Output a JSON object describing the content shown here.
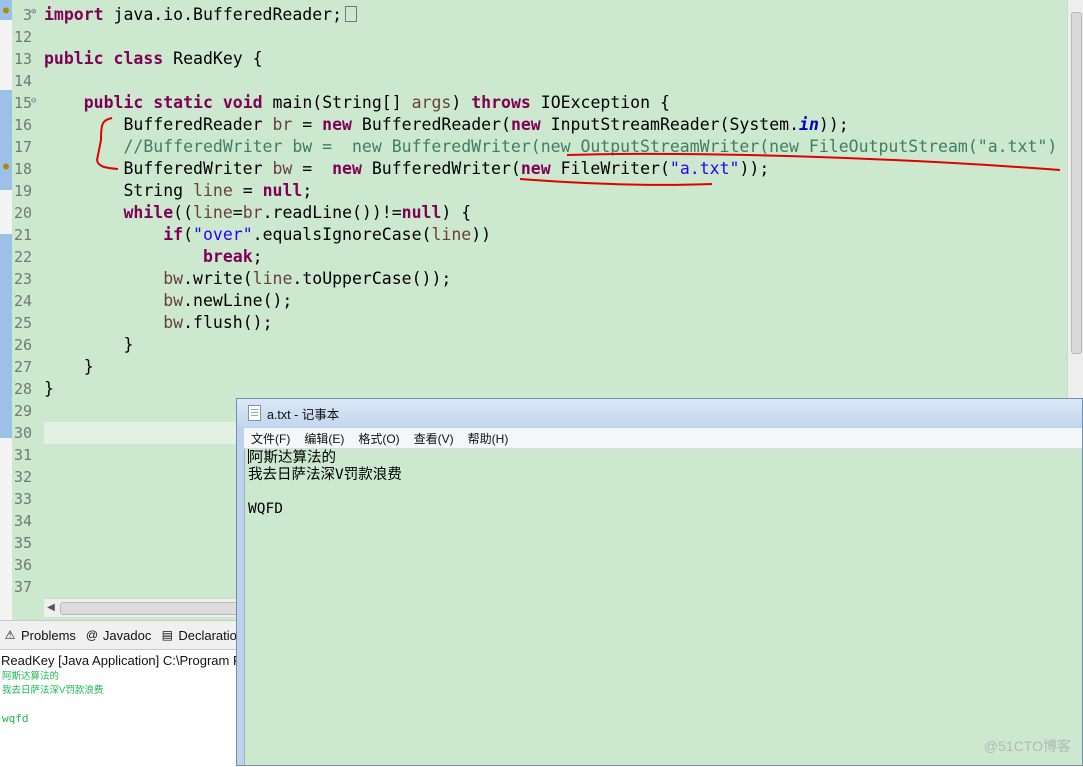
{
  "editor": {
    "lines": [
      {
        "num": "3",
        "segments": [
          {
            "t": "import",
            "c": "kw"
          },
          {
            "t": " java.io.BufferedReader;",
            "c": ""
          }
        ],
        "collapsed": true
      },
      {
        "num": "12",
        "segments": []
      },
      {
        "num": "13",
        "segments": [
          {
            "t": "public",
            "c": "kw"
          },
          {
            "t": " ",
            "c": ""
          },
          {
            "t": "class",
            "c": "kw"
          },
          {
            "t": " ReadKey {",
            "c": ""
          }
        ]
      },
      {
        "num": "14",
        "segments": []
      },
      {
        "num": "15",
        "segments": [
          {
            "t": "    ",
            "c": ""
          },
          {
            "t": "public",
            "c": "kw"
          },
          {
            "t": " ",
            "c": ""
          },
          {
            "t": "static",
            "c": "kw"
          },
          {
            "t": " ",
            "c": ""
          },
          {
            "t": "void",
            "c": "kw"
          },
          {
            "t": " main(String[] ",
            "c": ""
          },
          {
            "t": "args",
            "c": "var"
          },
          {
            "t": ") ",
            "c": ""
          },
          {
            "t": "throws",
            "c": "kw"
          },
          {
            "t": " IOException {",
            "c": ""
          }
        ]
      },
      {
        "num": "16",
        "segments": [
          {
            "t": "        BufferedReader ",
            "c": ""
          },
          {
            "t": "br",
            "c": "var"
          },
          {
            "t": " = ",
            "c": ""
          },
          {
            "t": "new",
            "c": "kw"
          },
          {
            "t": " BufferedReader(",
            "c": ""
          },
          {
            "t": "new",
            "c": "kw"
          },
          {
            "t": " InputStreamReader(System.",
            "c": ""
          },
          {
            "t": "in",
            "c": "fld"
          },
          {
            "t": "));",
            "c": ""
          }
        ]
      },
      {
        "num": "17",
        "segments": [
          {
            "t": "        ",
            "c": ""
          },
          {
            "t": "//BufferedWriter bw =  new BufferedWriter(new OutputStreamWriter(new FileOutputStream(\"a.txt\")",
            "c": "cm"
          }
        ]
      },
      {
        "num": "18",
        "segments": [
          {
            "t": "        BufferedWriter ",
            "c": ""
          },
          {
            "t": "bw",
            "c": "var"
          },
          {
            "t": " =  ",
            "c": ""
          },
          {
            "t": "new",
            "c": "kw"
          },
          {
            "t": " BufferedWriter(",
            "c": ""
          },
          {
            "t": "new",
            "c": "kw"
          },
          {
            "t": " FileWriter(",
            "c": ""
          },
          {
            "t": "\"a.txt\"",
            "c": "str"
          },
          {
            "t": "));",
            "c": ""
          }
        ]
      },
      {
        "num": "19",
        "segments": [
          {
            "t": "        String ",
            "c": ""
          },
          {
            "t": "line",
            "c": "var"
          },
          {
            "t": " = ",
            "c": ""
          },
          {
            "t": "null",
            "c": "kw"
          },
          {
            "t": ";",
            "c": ""
          }
        ]
      },
      {
        "num": "20",
        "segments": [
          {
            "t": "        ",
            "c": ""
          },
          {
            "t": "while",
            "c": "kw"
          },
          {
            "t": "((",
            "c": ""
          },
          {
            "t": "line",
            "c": "var"
          },
          {
            "t": "=",
            "c": ""
          },
          {
            "t": "br",
            "c": "var"
          },
          {
            "t": ".readLine())!=",
            "c": ""
          },
          {
            "t": "null",
            "c": "kw"
          },
          {
            "t": ") {",
            "c": ""
          }
        ]
      },
      {
        "num": "21",
        "segments": [
          {
            "t": "            ",
            "c": ""
          },
          {
            "t": "if",
            "c": "kw"
          },
          {
            "t": "(",
            "c": ""
          },
          {
            "t": "\"over\"",
            "c": "str"
          },
          {
            "t": ".equalsIgnoreCase(",
            "c": ""
          },
          {
            "t": "line",
            "c": "var"
          },
          {
            "t": "))",
            "c": ""
          }
        ]
      },
      {
        "num": "22",
        "segments": [
          {
            "t": "                ",
            "c": ""
          },
          {
            "t": "break",
            "c": "kw"
          },
          {
            "t": ";",
            "c": ""
          }
        ]
      },
      {
        "num": "23",
        "segments": [
          {
            "t": "            ",
            "c": ""
          },
          {
            "t": "bw",
            "c": "var"
          },
          {
            "t": ".write(",
            "c": ""
          },
          {
            "t": "line",
            "c": "var"
          },
          {
            "t": ".toUpperCase());",
            "c": ""
          }
        ]
      },
      {
        "num": "24",
        "segments": [
          {
            "t": "            ",
            "c": ""
          },
          {
            "t": "bw",
            "c": "var"
          },
          {
            "t": ".newLine();",
            "c": ""
          }
        ]
      },
      {
        "num": "25",
        "segments": [
          {
            "t": "            ",
            "c": ""
          },
          {
            "t": "bw",
            "c": "var"
          },
          {
            "t": ".flush();",
            "c": ""
          }
        ]
      },
      {
        "num": "26",
        "segments": [
          {
            "t": "        }",
            "c": ""
          }
        ]
      },
      {
        "num": "27",
        "segments": [
          {
            "t": "    }",
            "c": ""
          }
        ]
      },
      {
        "num": "28",
        "segments": [
          {
            "t": "}",
            "c": ""
          }
        ]
      },
      {
        "num": "29",
        "segments": []
      },
      {
        "num": "30",
        "segments": []
      },
      {
        "num": "31",
        "segments": []
      },
      {
        "num": "32",
        "segments": []
      },
      {
        "num": "33",
        "segments": []
      },
      {
        "num": "34",
        "segments": []
      },
      {
        "num": "35",
        "segments": []
      },
      {
        "num": "36",
        "segments": []
      },
      {
        "num": "37",
        "segments": []
      }
    ]
  },
  "console": {
    "tabs": [
      {
        "label": "Problems",
        "icon": "problems-icon",
        "glyph": "⚠"
      },
      {
        "label": "Javadoc",
        "icon": "javadoc-icon",
        "glyph": "@"
      },
      {
        "label": "Declaration",
        "icon": "declaration-icon",
        "glyph": "▤"
      }
    ],
    "title": "ReadKey [Java Application] C:\\Program Files",
    "output": [
      "阿斯达算法的",
      "我去日萨法深V罚款浪费",
      "",
      "wqfd"
    ]
  },
  "notepad": {
    "title": "a.txt - 记事本",
    "menu": [
      "文件(F)",
      "编辑(E)",
      "格式(O)",
      "查看(V)",
      "帮助(H)"
    ],
    "content": [
      "阿斯达算法的",
      "我去日萨法深V罚款浪费",
      "",
      "WQFD"
    ]
  },
  "watermark": "@51CTO博客",
  "colors": {
    "editor_bg": "#cce8cf",
    "keyword": "#7f0055",
    "string": "#2a00ff",
    "comment": "#3f7f5f",
    "annotation": "#e00000",
    "console_output": "#1bb84f"
  }
}
